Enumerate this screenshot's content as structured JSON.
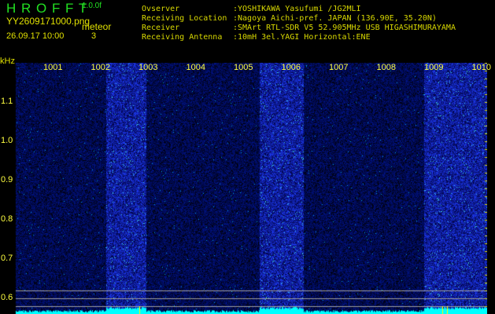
{
  "app": {
    "title_letters": "H R O F F T",
    "version": "1.0.0f"
  },
  "file": {
    "name": "YY2609171000.png",
    "datetime": "26.09.17 10:00"
  },
  "meteor": {
    "label": "meteor",
    "count": "3"
  },
  "info": [
    {
      "label": "Ovserver",
      "value": ":YOSHIKAWA Yasufumi /JG2MLI"
    },
    {
      "label": "Receiving Location",
      "value": ":Nagoya Aichi-pref. JAPAN (136.90E, 35.20N)"
    },
    {
      "label": "Receiver",
      "value": ":SMArt RTL-SDR V5 52.905MHz USB HIGASHIMURAYAMA"
    },
    {
      "label": "Receiving Antenna",
      "value": ":10mH 3el.YAGI Horizontal:ENE"
    }
  ],
  "axis": {
    "y_unit": "kHz",
    "x_ticks": [
      "1001",
      "1002",
      "1003",
      "1004",
      "1005",
      "1006",
      "1007",
      "1008",
      "1009",
      "1010"
    ],
    "y_ticks": [
      "1.1",
      "1.0",
      "0.9",
      "0.8",
      "0.7",
      "0.6"
    ]
  },
  "colors": {
    "background": "#000000",
    "signal": "#00ffff",
    "noise": "#1020a0",
    "text": "#e0e000"
  }
}
